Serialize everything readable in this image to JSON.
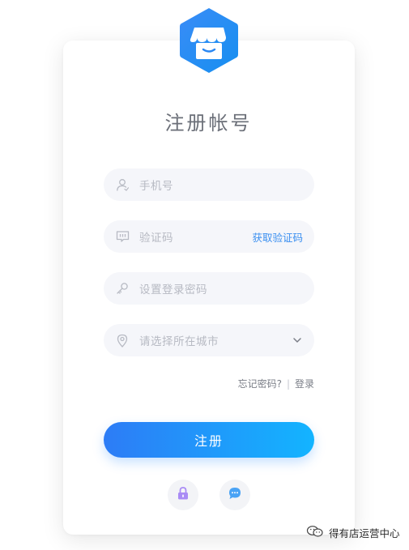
{
  "page": {
    "title": "注册帐号"
  },
  "brand": {
    "logo_icon": "store-awning-icon",
    "gradient_from": "#1f7cf2",
    "gradient_to": "#1ba6f5"
  },
  "form": {
    "phone": {
      "placeholder": "手机号",
      "icon": "user-icon"
    },
    "code": {
      "placeholder": "验证码",
      "icon": "message-icon",
      "action_label": "获取验证码"
    },
    "password": {
      "placeholder": "设置登录密码",
      "icon": "key-icon"
    },
    "city": {
      "placeholder": "请选择所在城市",
      "icon": "location-pin-icon",
      "dropdown_icon": "chevron-down-icon"
    }
  },
  "links": {
    "forgot": "忘记密码?",
    "separator": "|",
    "login": "登录"
  },
  "submit_label": "注册",
  "alt_buttons": [
    {
      "icon": "lock-icon",
      "color": "#a98bf5"
    },
    {
      "icon": "chat-bubble-icon",
      "color": "#4aa3f5"
    }
  ],
  "accent_color": "#2d7cf6",
  "watermark": {
    "text": "得有店运营中心"
  }
}
